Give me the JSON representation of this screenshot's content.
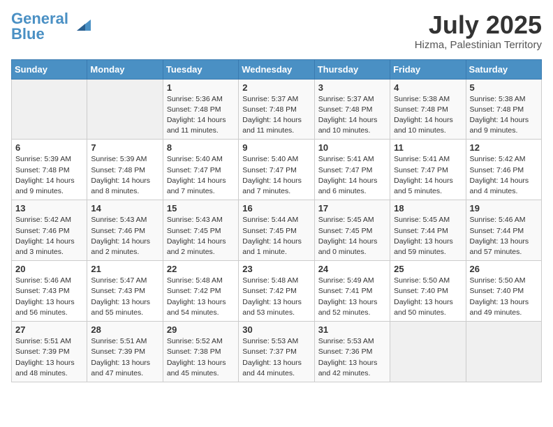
{
  "header": {
    "logo_general": "General",
    "logo_blue": "Blue",
    "month": "July 2025",
    "location": "Hizma, Palestinian Territory"
  },
  "weekdays": [
    "Sunday",
    "Monday",
    "Tuesday",
    "Wednesday",
    "Thursday",
    "Friday",
    "Saturday"
  ],
  "weeks": [
    [
      {
        "day": "",
        "empty": true
      },
      {
        "day": "",
        "empty": true
      },
      {
        "day": "1",
        "sunrise": "Sunrise: 5:36 AM",
        "sunset": "Sunset: 7:48 PM",
        "daylight": "Daylight: 14 hours and 11 minutes."
      },
      {
        "day": "2",
        "sunrise": "Sunrise: 5:37 AM",
        "sunset": "Sunset: 7:48 PM",
        "daylight": "Daylight: 14 hours and 11 minutes."
      },
      {
        "day": "3",
        "sunrise": "Sunrise: 5:37 AM",
        "sunset": "Sunset: 7:48 PM",
        "daylight": "Daylight: 14 hours and 10 minutes."
      },
      {
        "day": "4",
        "sunrise": "Sunrise: 5:38 AM",
        "sunset": "Sunset: 7:48 PM",
        "daylight": "Daylight: 14 hours and 10 minutes."
      },
      {
        "day": "5",
        "sunrise": "Sunrise: 5:38 AM",
        "sunset": "Sunset: 7:48 PM",
        "daylight": "Daylight: 14 hours and 9 minutes."
      }
    ],
    [
      {
        "day": "6",
        "sunrise": "Sunrise: 5:39 AM",
        "sunset": "Sunset: 7:48 PM",
        "daylight": "Daylight: 14 hours and 9 minutes."
      },
      {
        "day": "7",
        "sunrise": "Sunrise: 5:39 AM",
        "sunset": "Sunset: 7:48 PM",
        "daylight": "Daylight: 14 hours and 8 minutes."
      },
      {
        "day": "8",
        "sunrise": "Sunrise: 5:40 AM",
        "sunset": "Sunset: 7:47 PM",
        "daylight": "Daylight: 14 hours and 7 minutes."
      },
      {
        "day": "9",
        "sunrise": "Sunrise: 5:40 AM",
        "sunset": "Sunset: 7:47 PM",
        "daylight": "Daylight: 14 hours and 7 minutes."
      },
      {
        "day": "10",
        "sunrise": "Sunrise: 5:41 AM",
        "sunset": "Sunset: 7:47 PM",
        "daylight": "Daylight: 14 hours and 6 minutes."
      },
      {
        "day": "11",
        "sunrise": "Sunrise: 5:41 AM",
        "sunset": "Sunset: 7:47 PM",
        "daylight": "Daylight: 14 hours and 5 minutes."
      },
      {
        "day": "12",
        "sunrise": "Sunrise: 5:42 AM",
        "sunset": "Sunset: 7:46 PM",
        "daylight": "Daylight: 14 hours and 4 minutes."
      }
    ],
    [
      {
        "day": "13",
        "sunrise": "Sunrise: 5:42 AM",
        "sunset": "Sunset: 7:46 PM",
        "daylight": "Daylight: 14 hours and 3 minutes."
      },
      {
        "day": "14",
        "sunrise": "Sunrise: 5:43 AM",
        "sunset": "Sunset: 7:46 PM",
        "daylight": "Daylight: 14 hours and 2 minutes."
      },
      {
        "day": "15",
        "sunrise": "Sunrise: 5:43 AM",
        "sunset": "Sunset: 7:45 PM",
        "daylight": "Daylight: 14 hours and 2 minutes."
      },
      {
        "day": "16",
        "sunrise": "Sunrise: 5:44 AM",
        "sunset": "Sunset: 7:45 PM",
        "daylight": "Daylight: 14 hours and 1 minute."
      },
      {
        "day": "17",
        "sunrise": "Sunrise: 5:45 AM",
        "sunset": "Sunset: 7:45 PM",
        "daylight": "Daylight: 14 hours and 0 minutes."
      },
      {
        "day": "18",
        "sunrise": "Sunrise: 5:45 AM",
        "sunset": "Sunset: 7:44 PM",
        "daylight": "Daylight: 13 hours and 59 minutes."
      },
      {
        "day": "19",
        "sunrise": "Sunrise: 5:46 AM",
        "sunset": "Sunset: 7:44 PM",
        "daylight": "Daylight: 13 hours and 57 minutes."
      }
    ],
    [
      {
        "day": "20",
        "sunrise": "Sunrise: 5:46 AM",
        "sunset": "Sunset: 7:43 PM",
        "daylight": "Daylight: 13 hours and 56 minutes."
      },
      {
        "day": "21",
        "sunrise": "Sunrise: 5:47 AM",
        "sunset": "Sunset: 7:43 PM",
        "daylight": "Daylight: 13 hours and 55 minutes."
      },
      {
        "day": "22",
        "sunrise": "Sunrise: 5:48 AM",
        "sunset": "Sunset: 7:42 PM",
        "daylight": "Daylight: 13 hours and 54 minutes."
      },
      {
        "day": "23",
        "sunrise": "Sunrise: 5:48 AM",
        "sunset": "Sunset: 7:42 PM",
        "daylight": "Daylight: 13 hours and 53 minutes."
      },
      {
        "day": "24",
        "sunrise": "Sunrise: 5:49 AM",
        "sunset": "Sunset: 7:41 PM",
        "daylight": "Daylight: 13 hours and 52 minutes."
      },
      {
        "day": "25",
        "sunrise": "Sunrise: 5:50 AM",
        "sunset": "Sunset: 7:40 PM",
        "daylight": "Daylight: 13 hours and 50 minutes."
      },
      {
        "day": "26",
        "sunrise": "Sunrise: 5:50 AM",
        "sunset": "Sunset: 7:40 PM",
        "daylight": "Daylight: 13 hours and 49 minutes."
      }
    ],
    [
      {
        "day": "27",
        "sunrise": "Sunrise: 5:51 AM",
        "sunset": "Sunset: 7:39 PM",
        "daylight": "Daylight: 13 hours and 48 minutes."
      },
      {
        "day": "28",
        "sunrise": "Sunrise: 5:51 AM",
        "sunset": "Sunset: 7:39 PM",
        "daylight": "Daylight: 13 hours and 47 minutes."
      },
      {
        "day": "29",
        "sunrise": "Sunrise: 5:52 AM",
        "sunset": "Sunset: 7:38 PM",
        "daylight": "Daylight: 13 hours and 45 minutes."
      },
      {
        "day": "30",
        "sunrise": "Sunrise: 5:53 AM",
        "sunset": "Sunset: 7:37 PM",
        "daylight": "Daylight: 13 hours and 44 minutes."
      },
      {
        "day": "31",
        "sunrise": "Sunrise: 5:53 AM",
        "sunset": "Sunset: 7:36 PM",
        "daylight": "Daylight: 13 hours and 42 minutes."
      },
      {
        "day": "",
        "empty": true
      },
      {
        "day": "",
        "empty": true
      }
    ]
  ]
}
